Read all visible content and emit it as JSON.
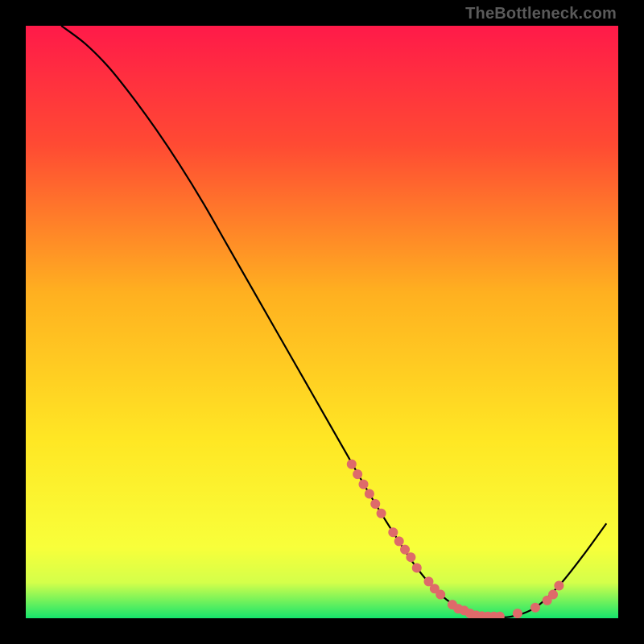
{
  "watermark": "TheBottleneck.com",
  "chart_data": {
    "type": "line",
    "title": "",
    "xlabel": "",
    "ylabel": "",
    "xlim": [
      0,
      100
    ],
    "ylim": [
      0,
      100
    ],
    "gradient_stops": [
      {
        "offset": 0,
        "color": "#ff1a49"
      },
      {
        "offset": 20,
        "color": "#ff4a33"
      },
      {
        "offset": 45,
        "color": "#ffb020"
      },
      {
        "offset": 70,
        "color": "#ffe724"
      },
      {
        "offset": 88,
        "color": "#f8ff3a"
      },
      {
        "offset": 94,
        "color": "#d4ff4a"
      },
      {
        "offset": 100,
        "color": "#16e56c"
      }
    ],
    "series": [
      {
        "name": "bottleneck-curve",
        "x": [
          6,
          10,
          14,
          18,
          22,
          26,
          30,
          34,
          38,
          42,
          46,
          50,
          54,
          58,
          62,
          66,
          70,
          74,
          78,
          82,
          86,
          90,
          94,
          98
        ],
        "y": [
          100,
          97,
          93,
          88,
          82.5,
          76.5,
          70,
          63,
          56,
          49,
          42,
          35,
          28,
          21,
          14.5,
          8.5,
          4,
          1.3,
          0.3,
          0.3,
          1.8,
          5.5,
          10.5,
          16
        ]
      }
    ],
    "scatter": {
      "name": "highlighted-points",
      "x": [
        55,
        56,
        57,
        58,
        59,
        60,
        62,
        63,
        64,
        65,
        66,
        68,
        69,
        70,
        72,
        73,
        74,
        75,
        76,
        77,
        78,
        79,
        80,
        83,
        86,
        88,
        89,
        90
      ],
      "y": [
        26,
        24.3,
        22.6,
        21,
        19.3,
        17.7,
        14.5,
        13,
        11.6,
        10.3,
        8.5,
        6.2,
        5,
        4,
        2.3,
        1.6,
        1.3,
        0.8,
        0.5,
        0.35,
        0.3,
        0.3,
        0.3,
        0.8,
        1.8,
        3,
        4,
        5.5
      ],
      "color": "#de6a6a",
      "radius": 6
    }
  }
}
